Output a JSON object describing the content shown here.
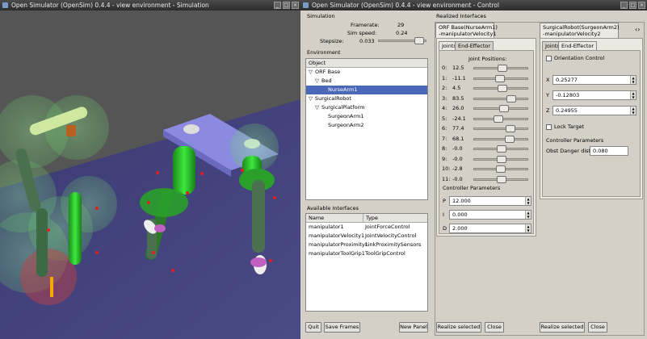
{
  "sim_window": {
    "title": "Open Simulator (OpenSim) 0.4.4 - view environment - Simulation"
  },
  "control_window": {
    "title": "Open Simulator (OpenSim) 0.4.4 - view environment - Control",
    "simulation": {
      "label": "Simulation",
      "framerate_label": "Framerate:",
      "framerate_value": "29",
      "simspeed_label": "Sim speed:",
      "simspeed_value": "0.24",
      "stepsize_label": "Stepsize:",
      "stepsize_value": "0.033"
    },
    "environment": {
      "label": "Environment",
      "column": "Object",
      "items": [
        {
          "label": "ORF Base",
          "indent": 0,
          "arrow": "▽",
          "selected": false
        },
        {
          "label": "Bed",
          "indent": 1,
          "arrow": "▽",
          "selected": false
        },
        {
          "label": "NurseArm1",
          "indent": 2,
          "arrow": "",
          "selected": true
        },
        {
          "label": "SurgicalRobot",
          "indent": 0,
          "arrow": "▽",
          "selected": false
        },
        {
          "label": "SurgicalPlatform",
          "indent": 1,
          "arrow": "▽",
          "selected": false
        },
        {
          "label": "SurgeonArm1",
          "indent": 2,
          "arrow": "",
          "selected": false
        },
        {
          "label": "SurgeonArm2",
          "indent": 2,
          "arrow": "",
          "selected": false
        }
      ]
    },
    "available": {
      "label": "Available Interfaces",
      "columns": [
        "Name",
        "Type"
      ],
      "rows": [
        [
          "manipulator1",
          "JointForceControl"
        ],
        [
          "manipulatorVelocity1",
          "JointVelocityControl"
        ],
        [
          "manipulatorProximity1",
          "LinkProximitySensors"
        ],
        [
          "manipulatorToolGrip1",
          "ToolGripControl"
        ]
      ]
    },
    "buttons": {
      "quit": "Quit",
      "save_frames": "Save Frames",
      "new_panel": "New Panel",
      "realize_left": "Realize selected",
      "close_left": "Close",
      "realize_right": "Realize selected",
      "close_right": "Close"
    },
    "realized": {
      "label": "Realized Interfaces",
      "panel1": {
        "title_line1": "ORF Base(NurseArm1)",
        "title_line2": "-manipulatorVelocity1",
        "tabs": [
          "Joints",
          "End-Effector"
        ],
        "joint_positions_label": "Joint Positions:",
        "joints": [
          {
            "index": "0:",
            "value": "12.5",
            "pos": 0.52
          },
          {
            "index": "1:",
            "value": "-11.1",
            "pos": 0.47
          },
          {
            "index": "2:",
            "value": "4.5",
            "pos": 0.51
          },
          {
            "index": "3:",
            "value": "83.5",
            "pos": 0.72
          },
          {
            "index": "4:",
            "value": "26.0",
            "pos": 0.56
          },
          {
            "index": "5:",
            "value": "-24.1",
            "pos": 0.43
          },
          {
            "index": "6:",
            "value": "77.4",
            "pos": 0.7
          },
          {
            "index": "7:",
            "value": "68.1",
            "pos": 0.68
          },
          {
            "index": "8:",
            "value": "-0.0",
            "pos": 0.5
          },
          {
            "index": "9:",
            "value": "-0.0",
            "pos": 0.5
          },
          {
            "index": "10:",
            "value": "-2.8",
            "pos": 0.49
          },
          {
            "index": "11:",
            "value": "-0.0",
            "pos": 0.5
          }
        ],
        "controller_label": "Controller Parameters",
        "params": [
          {
            "name": "P",
            "value": "12.000"
          },
          {
            "name": "I",
            "value": "0.000"
          },
          {
            "name": "D",
            "value": "2.000"
          }
        ]
      },
      "panel2": {
        "title_line1": "SurgicalRobot(SurgeonArm2)",
        "title_line2": "-manipulatorVelocity2",
        "tabs": [
          "Joints",
          "End-Effector"
        ],
        "orientation_label": "Orientation Control",
        "coords": [
          {
            "axis": "X",
            "value": "0.25277"
          },
          {
            "axis": "Y",
            "value": "-0.12803"
          },
          {
            "axis": "Z",
            "value": "0.24955"
          }
        ],
        "lock_label": "Lock Target",
        "controller_label": "Controller Parameters",
        "obst_label": "Obst Danger dist:",
        "obst_value": "0.080"
      }
    }
  }
}
